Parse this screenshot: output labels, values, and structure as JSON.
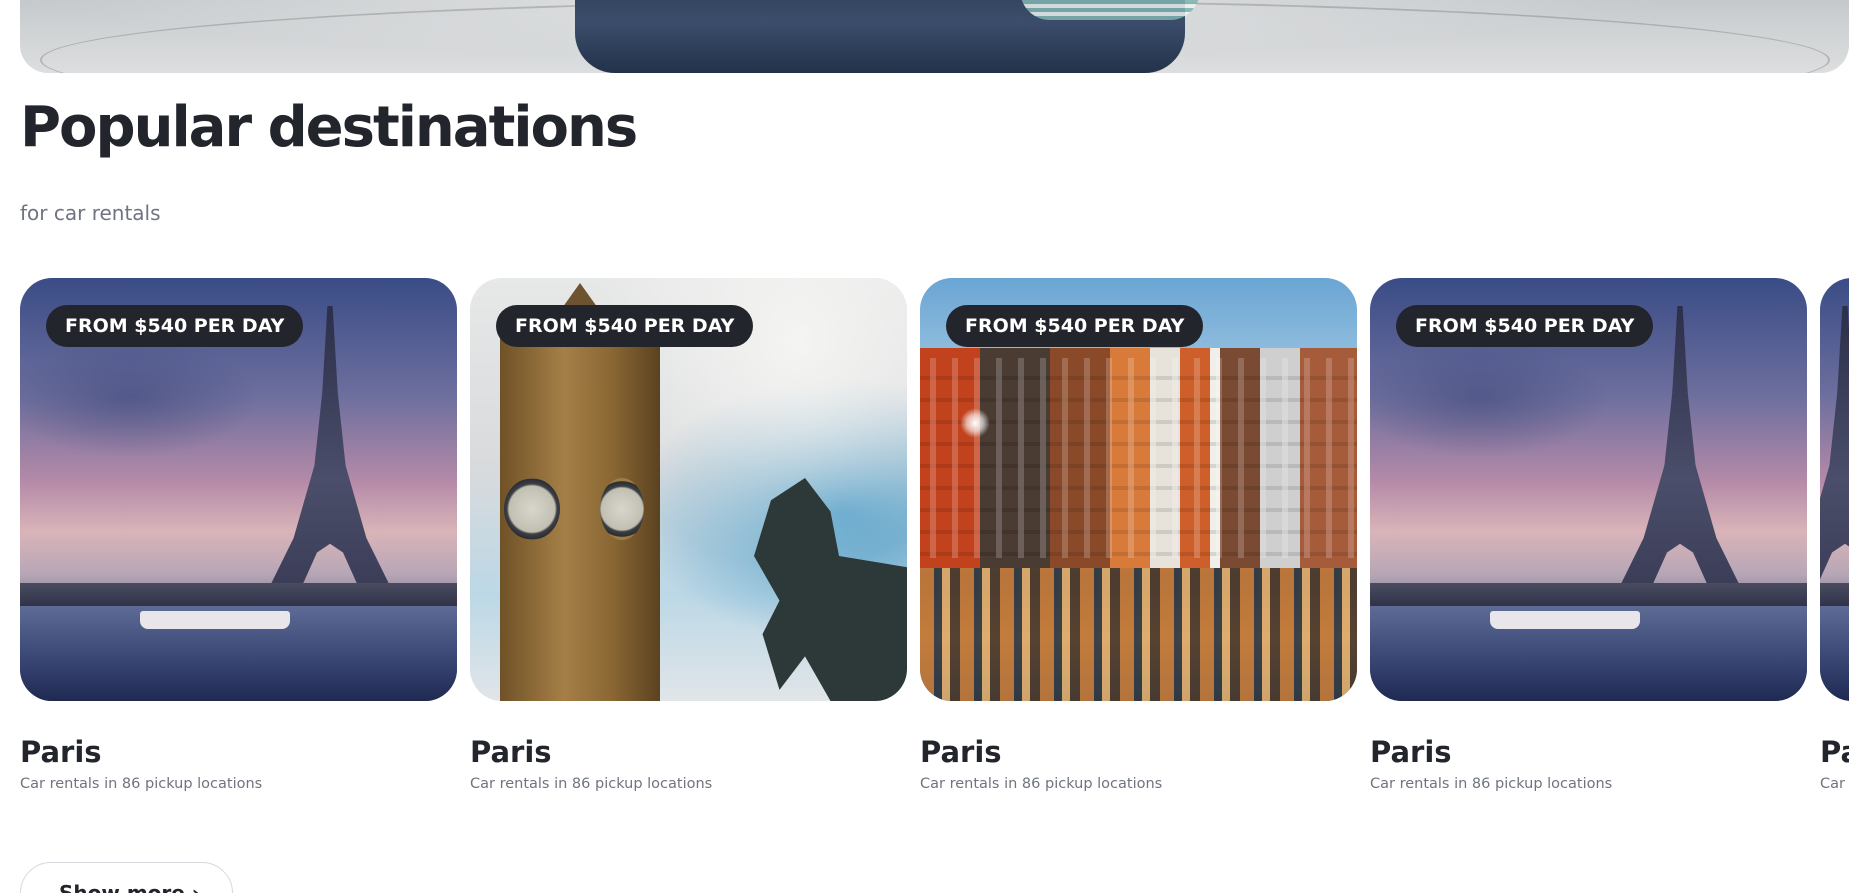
{
  "section": {
    "title": "Popular destinations",
    "subtitle": "for car rentals"
  },
  "cards": [
    {
      "badge": "FROM $540 PER DAY",
      "title": "Paris",
      "subtitle": "Car rentals in 86 pickup locations",
      "image": "eiffel-tower-photo"
    },
    {
      "badge": "FROM $540 PER DAY",
      "title": "Paris",
      "subtitle": "Car rentals in 86 pickup locations",
      "image": "big-ben-photo"
    },
    {
      "badge": "FROM $540 PER DAY",
      "title": "Paris",
      "subtitle": "Car rentals in 86 pickup locations",
      "image": "amsterdam-canal-photo"
    },
    {
      "badge": "FROM $540 PER DAY",
      "title": "Paris",
      "subtitle": "Car rentals in 86 pickup locations",
      "image": "eiffel-tower-photo"
    },
    {
      "badge": "",
      "title": "Pa",
      "subtitle": "Car",
      "image": "eiffel-tower-photo"
    }
  ],
  "show_more": {
    "label": "Show more ›"
  },
  "colors": {
    "badge_bg": "#23252c",
    "title": "#23252c",
    "muted": "#6f7480"
  }
}
